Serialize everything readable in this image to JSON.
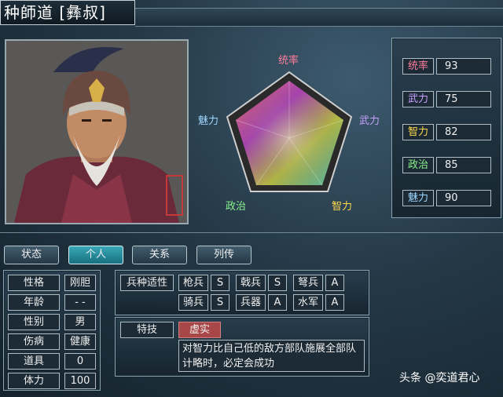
{
  "header": {
    "title": "种師道 [彝叔]"
  },
  "radar": {
    "labels": {
      "top": "统率",
      "right": "武力",
      "bottom_right": "智力",
      "bottom_left": "政治",
      "left": "魅力"
    }
  },
  "stats": [
    {
      "label": "统率",
      "value": "93",
      "color": "#ff7e9a"
    },
    {
      "label": "武力",
      "value": "75",
      "color": "#c7a0ff"
    },
    {
      "label": "智力",
      "value": "82",
      "color": "#ffd84a"
    },
    {
      "label": "政治",
      "value": "85",
      "color": "#8cf28c"
    },
    {
      "label": "魅力",
      "value": "90",
      "color": "#9fd6ff"
    }
  ],
  "tabs": [
    {
      "label": "状态"
    },
    {
      "label": "个人"
    },
    {
      "label": "关系"
    },
    {
      "label": "列传"
    }
  ],
  "personal": [
    {
      "label": "性格",
      "value": "刚胆"
    },
    {
      "label": "年龄",
      "value": "- -"
    },
    {
      "label": "性别",
      "value": "男"
    },
    {
      "label": "伤病",
      "value": "健康"
    },
    {
      "label": "道具",
      "value": "0"
    },
    {
      "label": "体力",
      "value": "100"
    }
  ],
  "aptitude": {
    "title": "兵种适性",
    "items": [
      {
        "unit": "枪兵",
        "grade": "S"
      },
      {
        "unit": "戟兵",
        "grade": "S"
      },
      {
        "unit": "弩兵",
        "grade": "A"
      },
      {
        "unit": "骑兵",
        "grade": "S"
      },
      {
        "unit": "兵器",
        "grade": "A"
      },
      {
        "unit": "水军",
        "grade": "A"
      }
    ]
  },
  "skill": {
    "label": "特技",
    "name": "虚实",
    "description": "对智力比自己低的敌方部队施展全部队计略时，必定会成功"
  },
  "watermark": "头条 @奕道君心",
  "colors": {
    "accent_tab": "#2a95a6",
    "skill_name_bg": "#a84747"
  }
}
